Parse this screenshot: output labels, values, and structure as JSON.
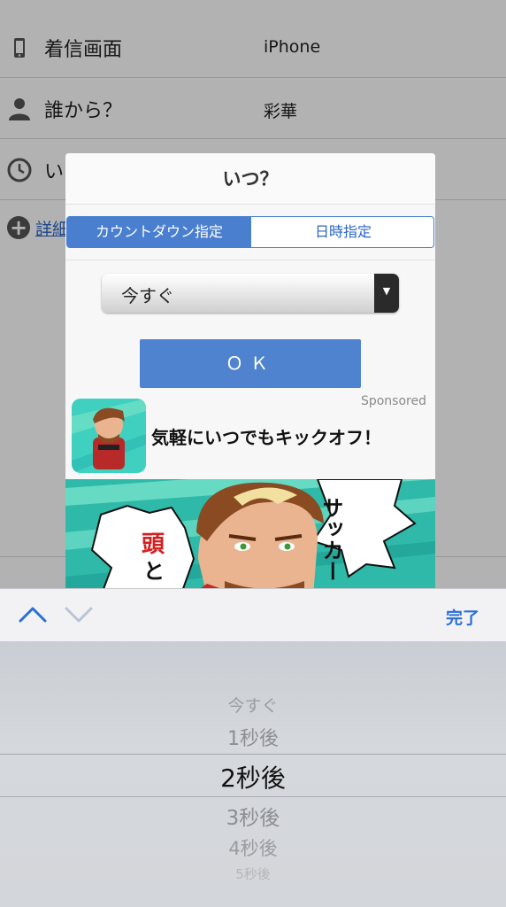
{
  "form": {
    "rows": [
      {
        "icon": "phone-icon",
        "label": "着信画面",
        "value": "iPhone"
      },
      {
        "icon": "person-icon",
        "label": "誰から？",
        "value": "彩華"
      },
      {
        "icon": "clock-icon",
        "label": "い",
        "value": ""
      }
    ],
    "details_link": "詳細"
  },
  "dialog": {
    "title": "いつ？",
    "segments": [
      "カウントダウン指定",
      "日時指定"
    ],
    "active_segment": 0,
    "select_value": "今すぐ",
    "ok_label": "ＯＫ",
    "ad": {
      "sponsored": "Sponsored",
      "title": "気軽にいつでもキックオフ！",
      "banner_text_right": "サッカー",
      "banner_text_left_red": "頭",
      "banner_text_left": "と"
    }
  },
  "toolbar": {
    "done_label": "完了"
  },
  "picker": {
    "options": [
      "今すぐ",
      "1秒後",
      "2秒後",
      "3秒後",
      "4秒後",
      "5秒後"
    ],
    "selected_index": 2
  },
  "colors": {
    "accent": "#4a7fd0",
    "ok_button": "#4f83cf",
    "done": "#2a6fd6"
  }
}
